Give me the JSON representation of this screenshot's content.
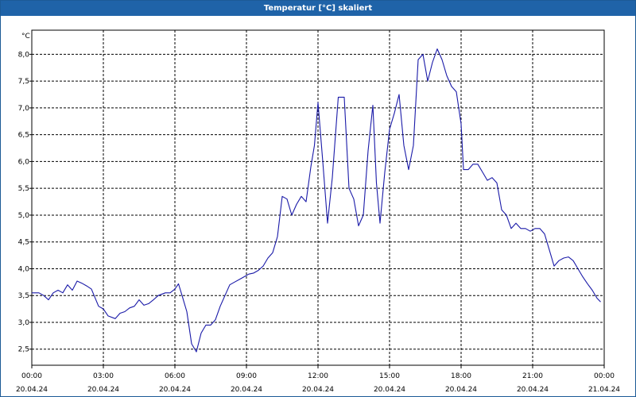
{
  "window": {
    "title": "Temperatur [°C] skaliert"
  },
  "chart_data": {
    "type": "line",
    "title": "Temperatur [°C] skaliert",
    "ylabel": "°C",
    "xlabel": "",
    "ylim": [
      2.2,
      8.45
    ],
    "xlim_hours": [
      0,
      24
    ],
    "grid": true,
    "line_color": "#1a1aa8",
    "y_ticks": [
      "2,5",
      "3,0",
      "3,5",
      "4,0",
      "4,5",
      "5,0",
      "5,5",
      "6,0",
      "6,5",
      "7,0",
      "7,5",
      "8,0"
    ],
    "x_ticks": [
      {
        "time": "00:00",
        "date": "20.04.24"
      },
      {
        "time": "03:00",
        "date": "20.04.24"
      },
      {
        "time": "06:00",
        "date": "20.04.24"
      },
      {
        "time": "09:00",
        "date": "20.04.24"
      },
      {
        "time": "12:00",
        "date": "20.04.24"
      },
      {
        "time": "15:00",
        "date": "20.04.24"
      },
      {
        "time": "18:00",
        "date": "20.04.24"
      },
      {
        "time": "21:00",
        "date": "20.04.24"
      },
      {
        "time": "00:00",
        "date": "21.04.24"
      }
    ],
    "series": [
      {
        "x": [
          0.0,
          0.3,
          0.5,
          0.7,
          0.9,
          1.1,
          1.3,
          1.5,
          1.7,
          1.9,
          2.1,
          2.3,
          2.5,
          2.8,
          3.0,
          3.2,
          3.5,
          3.7,
          3.9,
          4.1,
          4.3,
          4.5,
          4.7,
          4.9,
          5.1,
          5.3,
          5.6,
          5.8,
          6.0,
          6.15,
          6.3,
          6.5,
          6.7,
          6.9,
          7.1,
          7.3,
          7.5,
          7.7,
          7.9,
          8.1,
          8.3,
          8.5,
          8.7,
          8.9,
          9.1,
          9.3,
          9.5,
          9.7,
          9.9,
          10.1,
          10.3,
          10.5,
          10.7,
          10.9,
          11.1,
          11.3,
          11.5,
          11.7,
          11.85,
          12.0,
          12.2,
          12.4,
          12.6,
          12.85,
          13.1,
          13.3,
          13.5,
          13.7,
          13.9,
          14.1,
          14.3,
          14.45,
          14.6,
          14.8,
          15.0,
          15.2,
          15.4,
          15.6,
          15.8,
          16.0,
          16.2,
          16.4,
          16.6,
          16.8,
          17.0,
          17.2,
          17.4,
          17.6,
          17.8,
          18.0,
          18.1,
          18.3,
          18.5,
          18.7,
          18.9,
          19.1,
          19.3,
          19.5,
          19.7,
          19.9,
          20.1,
          20.3,
          20.5,
          20.7,
          20.9,
          21.1,
          21.3,
          21.5,
          21.7,
          21.9,
          22.1,
          22.3,
          22.5,
          22.7,
          22.9,
          23.1,
          23.3,
          23.5,
          23.7,
          23.85
        ],
        "values": [
          3.55,
          3.55,
          3.5,
          3.42,
          3.55,
          3.6,
          3.55,
          3.7,
          3.6,
          3.77,
          3.73,
          3.68,
          3.62,
          3.3,
          3.25,
          3.12,
          3.07,
          3.17,
          3.2,
          3.27,
          3.3,
          3.42,
          3.32,
          3.35,
          3.42,
          3.5,
          3.55,
          3.55,
          3.62,
          3.72,
          3.5,
          3.2,
          2.6,
          2.45,
          2.8,
          2.95,
          2.95,
          3.05,
          3.3,
          3.5,
          3.7,
          3.75,
          3.8,
          3.85,
          3.9,
          3.92,
          3.97,
          4.05,
          4.2,
          4.3,
          4.6,
          5.35,
          5.3,
          5.0,
          5.2,
          5.35,
          5.25,
          5.9,
          6.3,
          7.1,
          6.0,
          4.85,
          5.7,
          7.2,
          7.2,
          5.5,
          5.3,
          4.8,
          5.0,
          6.2,
          7.05,
          5.6,
          4.85,
          5.8,
          6.6,
          6.9,
          7.25,
          6.3,
          5.85,
          6.3,
          7.9,
          8.0,
          7.5,
          7.85,
          8.1,
          7.9,
          7.6,
          7.4,
          7.3,
          6.7,
          5.85,
          5.85,
          5.95,
          5.95,
          5.8,
          5.65,
          5.7,
          5.6,
          5.1,
          5.0,
          4.75,
          4.85,
          4.75,
          4.75,
          4.7,
          4.75,
          4.75,
          4.65,
          4.35,
          4.05,
          4.15,
          4.2,
          4.22,
          4.15,
          4.0,
          3.85,
          3.72,
          3.6,
          3.45,
          3.38
        ]
      }
    ]
  }
}
